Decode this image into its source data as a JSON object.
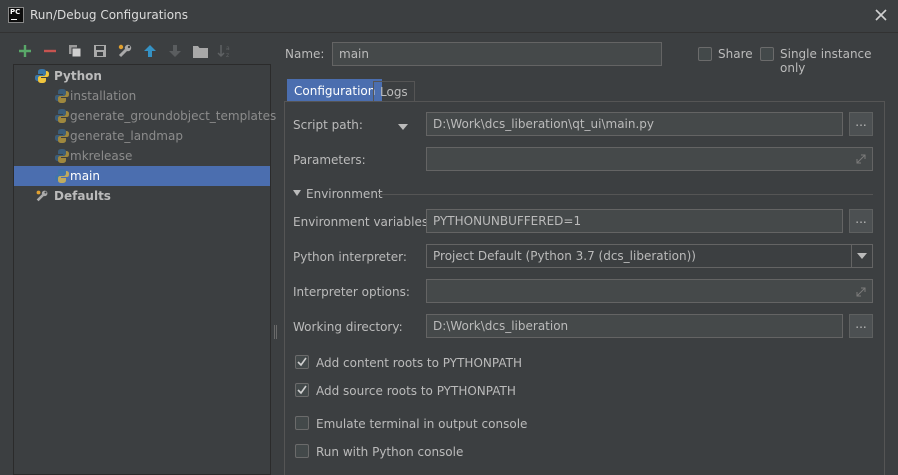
{
  "window": {
    "title": "Run/Debug Configurations",
    "app_icon": "PC"
  },
  "toolbar": {
    "icons": [
      "add-icon",
      "remove-icon",
      "copy-icon",
      "save-icon",
      "wrench-icon",
      "move-up-icon",
      "move-down-icon",
      "folder-icon",
      "sort-icon"
    ]
  },
  "tree": {
    "python_label": "Python",
    "items": [
      "installation",
      "generate_groundobject_templates",
      "generate_landmap",
      "mkrelease",
      "main"
    ],
    "selected": "main",
    "defaults_label": "Defaults"
  },
  "header": {
    "name_label": "Name:",
    "name_value": "main",
    "share_label": "Share",
    "single_instance_label": "Single instance only"
  },
  "tabs": [
    "Configuration",
    "Logs"
  ],
  "form": {
    "script_path_label": "Script path:",
    "script_path_value": "D:\\Work\\dcs_liberation\\qt_ui\\main.py",
    "parameters_label": "Parameters:",
    "parameters_value": "",
    "environment_section": "Environment",
    "env_vars_label": "Environment variables:",
    "env_vars_value": "PYTHONUNBUFFERED=1",
    "interpreter_label": "Python interpreter:",
    "interpreter_value": "Project Default (Python 3.7 (dcs_liberation))",
    "interpreter_options_label": "Interpreter options:",
    "interpreter_options_value": "",
    "working_dir_label": "Working directory:",
    "working_dir_value": "D:\\Work\\dcs_liberation",
    "dots": "..."
  },
  "checkboxes": [
    {
      "label": "Add content roots to PYTHONPATH",
      "checked": true
    },
    {
      "label": "Add source roots to PYTHONPATH",
      "checked": true
    },
    {
      "label": "Emulate terminal in output console",
      "checked": false
    },
    {
      "label": "Run with Python console",
      "checked": false
    }
  ],
  "colors": {
    "background": "#3c3f41",
    "selection": "#4b6eaf",
    "add": "#59a869",
    "remove": "#c75450",
    "arrow": "#3592c4"
  }
}
